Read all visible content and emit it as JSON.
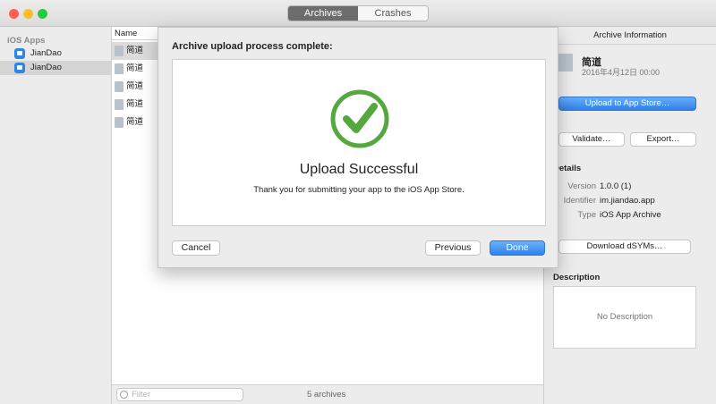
{
  "toolbar": {
    "tabs": [
      "Archives",
      "Crashes"
    ],
    "active_tab": "Archives"
  },
  "sidebar": {
    "heading": "iOS Apps",
    "items": [
      "JianDao",
      "JianDao"
    ]
  },
  "list": {
    "column": "Name",
    "rows": [
      "简道",
      "简道",
      "简道",
      "简道",
      "简道"
    ],
    "filter_placeholder": "Filter",
    "count": "5 archives"
  },
  "inspector": {
    "title": "Archive Information",
    "name": "简道",
    "date": "2016年4月12日 00:00",
    "upload_button": "Upload to App Store…",
    "validate_button": "Validate…",
    "export_button": "Export…",
    "details_title": "Details",
    "version_label": "Version",
    "version": "1.0.0 (1)",
    "identifier_label": "Identifier",
    "identifier": "im.jiandao.app",
    "type_label": "Type",
    "type": "iOS App Archive",
    "dsym_button": "Download dSYMs…",
    "description_title": "Description",
    "description": "No Description"
  },
  "sheet": {
    "title": "Archive upload process complete:",
    "success_title": "Upload Successful",
    "success_text": "Thank you for submitting your app to the iOS App Store.",
    "cancel": "Cancel",
    "previous": "Previous",
    "done": "Done"
  },
  "colors": {
    "accent": "#2f80eb",
    "success": "#55a83b"
  }
}
